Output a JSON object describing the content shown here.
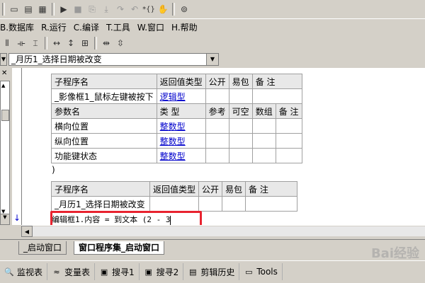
{
  "toolbar": {
    "icons": [
      "window-icon",
      "layout-icon",
      "grid-icon",
      "run-icon",
      "stop-icon",
      "step-icon",
      "step-into-icon",
      "step-over-icon",
      "step-out-icon",
      "braces-icon",
      "hand-icon",
      "binoculars-icon"
    ]
  },
  "menubar": {
    "items": [
      {
        "label": "B.数据库"
      },
      {
        "label": "R.运行"
      },
      {
        "label": "C.编译"
      },
      {
        "label": "T.工具"
      },
      {
        "label": "W.窗口"
      },
      {
        "label": "H.帮助"
      }
    ],
    "first_prefix": "B"
  },
  "combo": {
    "event_value": "_月历1_选择日期被改变"
  },
  "table1": {
    "header": [
      "子程序名",
      "返回值类型",
      "公开",
      "易包",
      "备 注"
    ],
    "row": [
      "_影像框1_鼠标左键被按下",
      "逻辑型",
      "",
      "",
      ""
    ],
    "param_header": [
      "参数名",
      "类 型",
      "参考",
      "可空",
      "数组",
      "备 注"
    ],
    "params": [
      [
        "横向位置",
        "整数型",
        "",
        "",
        "",
        ""
      ],
      [
        "纵向位置",
        "整数型",
        "",
        "",
        "",
        ""
      ],
      [
        "功能键状态",
        "整数型",
        "",
        "",
        "",
        ""
      ]
    ]
  },
  "code_paren": ")",
  "table2": {
    "header": [
      "子程序名",
      "返回值类型",
      "公开",
      "易包",
      "备 注"
    ],
    "row": [
      "_月历1_选择日期被改变",
      "",
      "",
      "",
      ""
    ]
  },
  "code_line": "编辑框1.内容 = 到文本 (2 - 3",
  "tabs": [
    {
      "label": "_启动窗口"
    },
    {
      "label": "窗口程序集_启动窗口"
    }
  ],
  "bottom": {
    "buttons": [
      {
        "label": "监视表",
        "icon": "watch-icon"
      },
      {
        "label": "变量表",
        "icon": "variables-icon"
      },
      {
        "label": "搜寻1",
        "icon": "search-icon"
      },
      {
        "label": "搜寻2",
        "icon": "search-icon"
      },
      {
        "label": "剪辑历史",
        "icon": "clipboard-icon"
      },
      {
        "label": "Tools",
        "icon": "tools-icon"
      }
    ]
  },
  "watermark": "Bai经验",
  "colors": {
    "highlight": "#e8232f",
    "link": "#0000cc",
    "chrome": "#d4d0c8"
  }
}
